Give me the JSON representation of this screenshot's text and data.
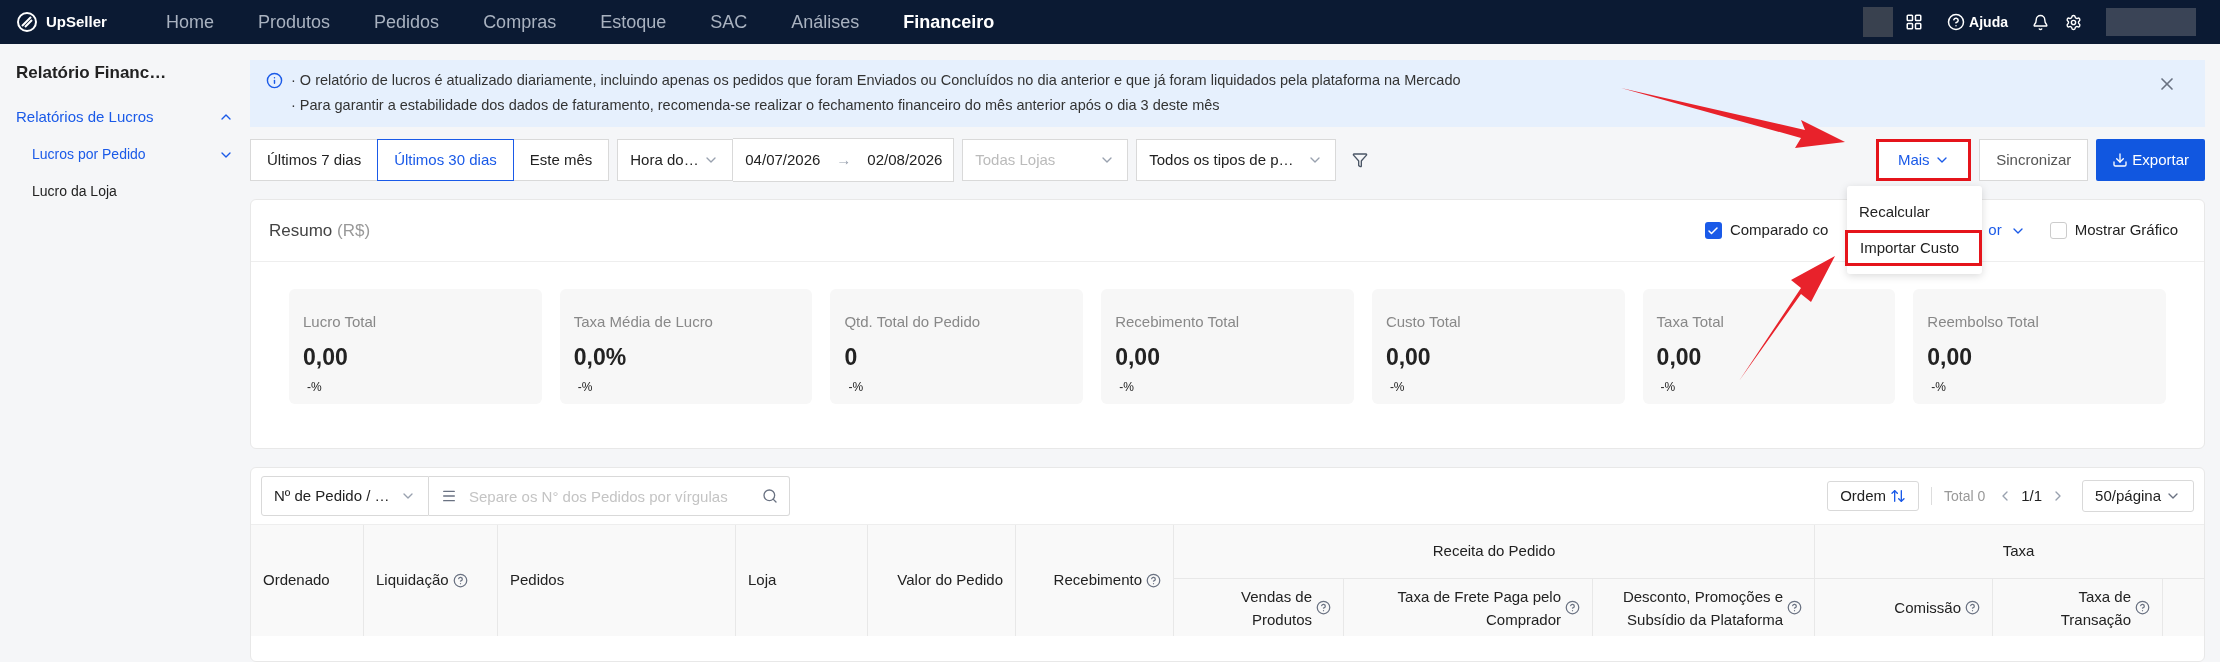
{
  "nav": {
    "logo": "UpSeller",
    "items": [
      {
        "label": "Home",
        "selected": false
      },
      {
        "label": "Produtos",
        "selected": false
      },
      {
        "label": "Pedidos",
        "selected": false
      },
      {
        "label": "Compras",
        "selected": false
      },
      {
        "label": "Estoque",
        "selected": false
      },
      {
        "label": "SAC",
        "selected": false
      },
      {
        "label": "Análises",
        "selected": false
      },
      {
        "label": "Financeiro",
        "selected": true
      }
    ],
    "help": "Ajuda"
  },
  "sidebar": {
    "title": "Relatório Financ…",
    "items": [
      {
        "label": "Relatórios de Lucros",
        "selected": true,
        "expanded": true,
        "children": [
          {
            "label": "Lucros por Pedido",
            "selected": true,
            "kind": "group"
          },
          {
            "label": "Lucro da Loja",
            "selected": false,
            "kind": "leaf"
          }
        ]
      }
    ]
  },
  "notice": {
    "lines": [
      "· O relatório de lucros é atualizado diariamente, incluindo apenas os pedidos que foram Enviados ou Concluídos no dia anterior e que já foram liquidados pela plataforma na Mercado",
      "· Para garantir a estabilidade dos dados de faturamento, recomenda-se realizar o fechamento financeiro do mês anterior após o dia 3 deste mês"
    ]
  },
  "filters": {
    "ranges": [
      {
        "label": "Últimos 7 dias",
        "selected": false
      },
      {
        "label": "Últimos 30 dias",
        "selected": true
      },
      {
        "label": "Este mês",
        "selected": false
      }
    ],
    "time_type": "Hora do…",
    "date_from": "04/07/2026",
    "date_separator": "→",
    "date_to": "02/08/2026",
    "store": {
      "placeholder": "Todas Lojas"
    },
    "order_type": "Todos os tipos de p…"
  },
  "actions": {
    "more": "Mais",
    "sync": "Sincronizar",
    "export": "Exportar"
  },
  "menu": {
    "items": [
      "Recalcular",
      "Importar Custo"
    ]
  },
  "summary": {
    "title": "Resumo",
    "unit": "(R$)",
    "compare": {
      "label": "Comparado co",
      "checked": true,
      "select": "or"
    },
    "show_chart": {
      "label": "Mostrar Gráfico",
      "checked": false
    },
    "cards": [
      {
        "label": "Lucro Total",
        "value": "0,00",
        "change": "-%"
      },
      {
        "label": "Taxa Média de Lucro",
        "value": "0,0%",
        "change": "-%"
      },
      {
        "label": "Qtd. Total do Pedido",
        "value": "0",
        "change": "-%"
      },
      {
        "label": "Recebimento Total",
        "value": "0,00",
        "change": "-%"
      },
      {
        "label": "Custo Total",
        "value": "0,00",
        "change": "-%"
      },
      {
        "label": "Taxa Total",
        "value": "0,00",
        "change": "-%"
      },
      {
        "label": "Reembolso Total",
        "value": "0,00",
        "change": "-%"
      }
    ]
  },
  "table": {
    "search_type": "Nº de Pedido / …",
    "search": {
      "placeholder": "Separe os N° dos Pedidos por vírgulas"
    },
    "sort": "Ordem",
    "total": "Total 0",
    "page": "1/1",
    "page_size": "50/página",
    "columns": [
      {
        "label": "Ordenado",
        "help": false
      },
      {
        "label": "Liquidação",
        "help": true
      },
      {
        "label": "Pedidos",
        "help": false
      },
      {
        "label": "Loja",
        "help": false
      },
      {
        "label": "Valor do Pedido",
        "help": false
      },
      {
        "label": "Recebimento",
        "help": true
      }
    ],
    "groups": [
      {
        "label": "Receita do Pedido",
        "columns": [
          {
            "label": "Vendas de Produtos",
            "help": true
          },
          {
            "label": "Taxa de Frete Paga pelo Comprador",
            "help": true
          },
          {
            "label": "Desconto, Promoções e Subsídio da Plataforma",
            "help": true
          }
        ]
      },
      {
        "label": "Taxa",
        "columns": [
          {
            "label": "Comissão",
            "help": true
          },
          {
            "label": "Taxa de Transação",
            "help": true
          }
        ]
      }
    ]
  }
}
